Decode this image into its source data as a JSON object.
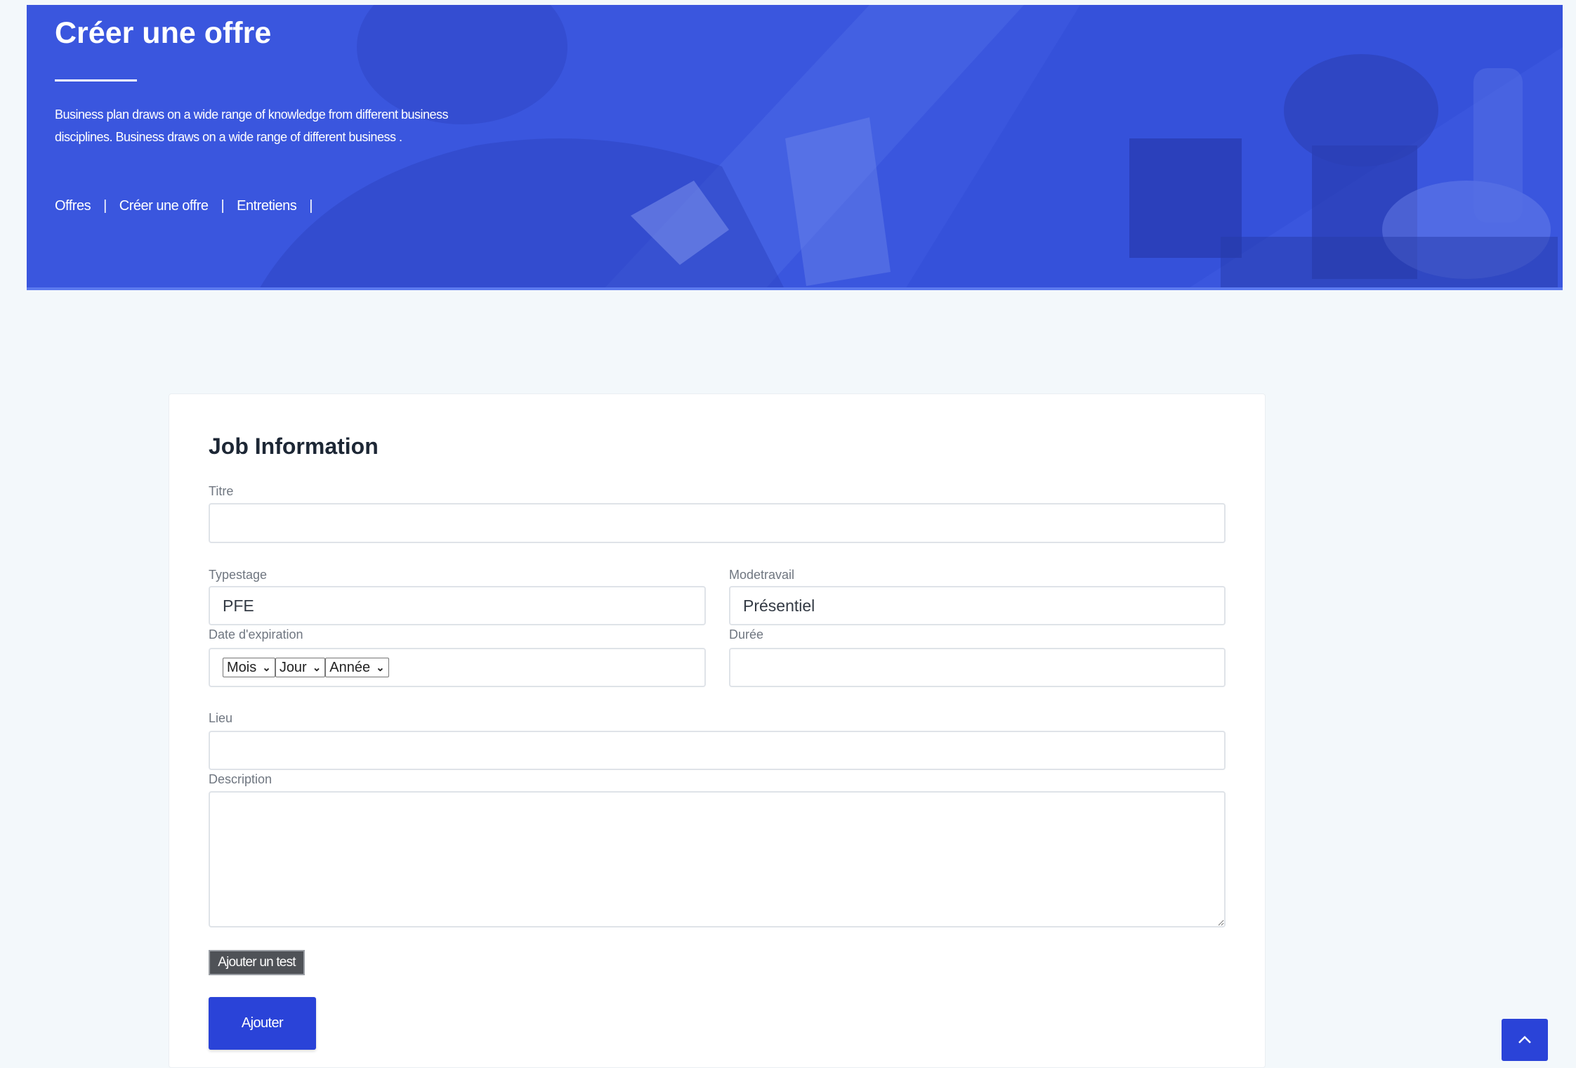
{
  "header": {
    "title": "Créer une offre",
    "intro_line1": "Business plan draws on a wide range of knowledge from different business",
    "intro_line2": "disciplines. Business draws on a wide range of different business .",
    "breadcrumbs": [
      "Offres",
      "Créer une offre",
      "Entretiens"
    ],
    "separator": "|",
    "accent_color": "#3a56de"
  },
  "form": {
    "title": "Job Information",
    "titre": {
      "label": "Titre",
      "value": ""
    },
    "typestage": {
      "label": "Typestage",
      "value": "PFE"
    },
    "modetravail": {
      "label": "Modetravail",
      "value": "Présentiel"
    },
    "date_expiration": {
      "label": "Date d'expiration",
      "mois": "Mois",
      "jour": "Jour",
      "annee": "Année"
    },
    "duree": {
      "label": "Durée",
      "value": ""
    },
    "lieu": {
      "label": "Lieu",
      "value": ""
    },
    "description": {
      "label": "Description",
      "value": ""
    },
    "add_test_label": "Ajouter un test",
    "submit_label": "Ajouter",
    "button_color": "#2a43d8"
  },
  "scroll_top_icon": "chevron-up-icon"
}
